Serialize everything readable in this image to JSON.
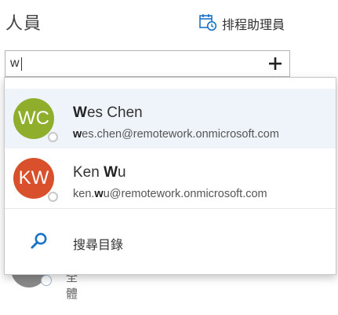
{
  "header": {
    "title": "人員",
    "scheduler_label": "排程助理員",
    "scheduler_icon": "calendar-clock-icon"
  },
  "search": {
    "value": "w",
    "add_icon": "plus-icon"
  },
  "background_item": {
    "label": "全體"
  },
  "suggestions": [
    {
      "initials": "WC",
      "avatar_color": "#8fae2b",
      "name_match": "W",
      "name_rest": "es Chen",
      "email_match": "w",
      "email_rest": "es.chen@remotework.onmicrosoft.com",
      "selected": true
    },
    {
      "initials": "KW",
      "avatar_color": "#d9512c",
      "name_prefix": "Ken ",
      "name_match": "W",
      "name_rest": "u",
      "email_prefix": "ken.",
      "email_match": "w",
      "email_rest": "u@remotework.onmicrosoft.com",
      "selected": false
    }
  ],
  "directory": {
    "label": "搜尋目錄",
    "icon": "search-icon",
    "accent": "#1a73c8"
  }
}
